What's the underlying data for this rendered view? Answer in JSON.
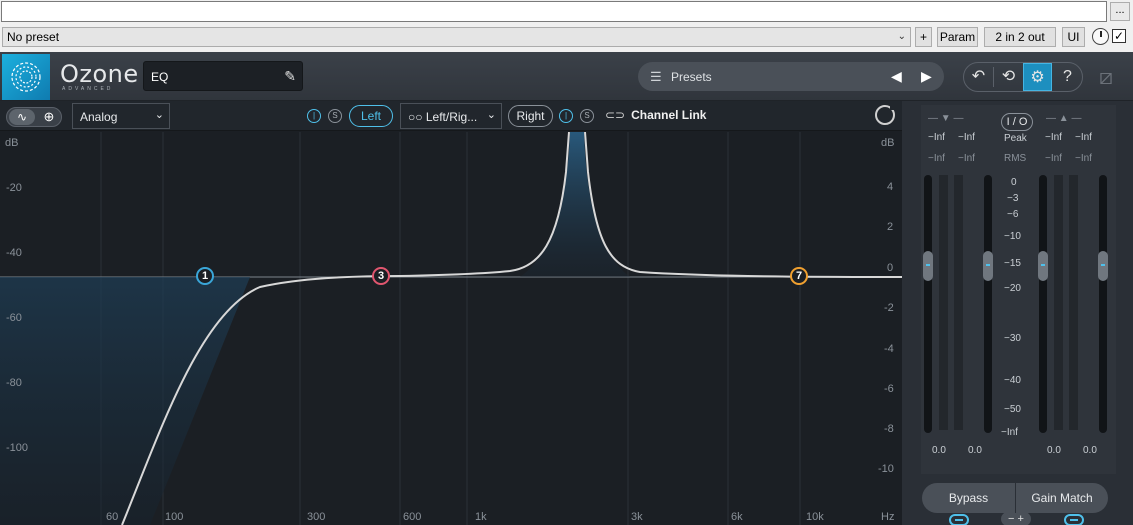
{
  "host": {
    "dots_label": "...",
    "preset_value": "No preset",
    "plus_label": "+",
    "param_label": "Param",
    "io_label": "2 in 2 out",
    "ui_label": "UI",
    "checkbox_mark": "✓"
  },
  "header": {
    "logo_name": "Ozone",
    "logo_sub": "ADVANCED",
    "module_name": "EQ",
    "presets_label": "Presets",
    "help_label": "?"
  },
  "toolbar": {
    "mode_select": "Analog",
    "solo_left": "S",
    "left_label": "Left",
    "lr_select": "Left/Rig...",
    "right_label": "Right",
    "solo_right": "S",
    "channel_link": "Channel Link"
  },
  "graph": {
    "db_unit_left": "dB",
    "db_unit_right": "dB",
    "left_scale": [
      "-20",
      "-40",
      "-60",
      "-80",
      "-100"
    ],
    "right_scale": [
      "4",
      "2",
      "0",
      "-2",
      "-4",
      "-6",
      "-8",
      "-10"
    ],
    "freq_scale": [
      "60",
      "100",
      "300",
      "600",
      "1k",
      "3k",
      "6k",
      "10k",
      "Hz"
    ],
    "nodes": [
      {
        "label": "1",
        "color": "#3aa6d8"
      },
      {
        "label": "3",
        "color": "#e0566f"
      },
      {
        "label": "7",
        "color": "#f0a030"
      }
    ]
  },
  "meters": {
    "io_label": "I / O",
    "peak_label": "Peak",
    "rms_label": "RMS",
    "in_peak": [
      "−Inf",
      "−Inf"
    ],
    "in_rms": [
      "−Inf",
      "−Inf"
    ],
    "out_peak": [
      "−Inf",
      "−Inf"
    ],
    "out_rms": [
      "−Inf",
      "−Inf"
    ],
    "scale": [
      "0",
      "−3",
      "−6",
      "−10",
      "−15",
      "−20",
      "−30",
      "−40",
      "−50",
      "−Inf"
    ],
    "in_gain": [
      "0.0",
      "0.0"
    ],
    "out_gain": [
      "0.0",
      "0.0"
    ],
    "plusminus": "− +",
    "bypass_label": "Bypass",
    "gain_match_label": "Gain Match"
  },
  "colors": {
    "accent": "#4fc0ea",
    "curve": "#d8d8d8"
  }
}
